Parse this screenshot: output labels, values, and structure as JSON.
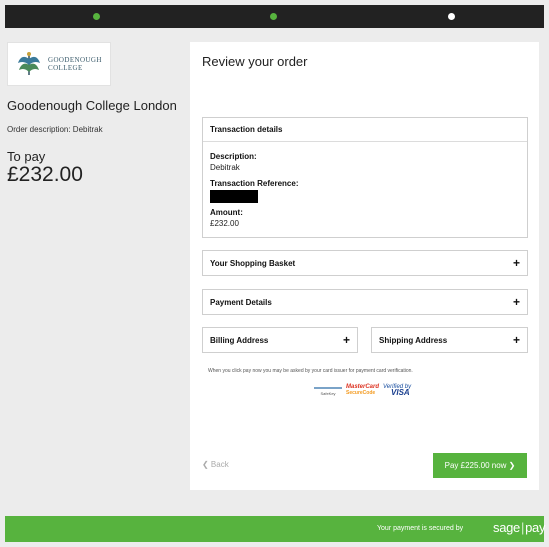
{
  "progress": {
    "total_steps": 3,
    "completed_steps": 2,
    "current_step": 3
  },
  "brand": {
    "logo_line1": "GOODENOUGH",
    "logo_line2": "COLLEGE",
    "crest_icon": "college-crest-icon",
    "accent_color": "#57b33e"
  },
  "summary": {
    "merchant": "Goodenough College London",
    "order_description": "Order description: Debitrak",
    "to_pay_label": "To pay",
    "to_pay_amount": "£232.00"
  },
  "review": {
    "title": "Review your order",
    "transaction": {
      "header": "Transaction details",
      "description_label": "Description:",
      "description_value": "Debitrak",
      "reference_label": "Transaction Reference:",
      "amount_label": "Amount:",
      "amount_value": "£232.00"
    },
    "sections": {
      "basket": "Your Shopping Basket",
      "payment": "Payment Details",
      "billing": "Billing Address",
      "shipping": "Shipping Address"
    },
    "expand_symbol": "+",
    "verification_note": "When you click pay now you may be asked by your card issuer for payment card verification.",
    "card_logos": {
      "safekey_text": "SafeKey",
      "mastercard_text": "MasterCard",
      "securecode_text": "SecureCode",
      "verified_by_text": "Verified by",
      "visa_text": "VISA"
    },
    "back_label": "❮ Back",
    "pay_label": "Pay £225.00 now ❯"
  },
  "footer": {
    "secure_text": "Your payment is secured by",
    "sage_text": "sage",
    "pay_text": "pay"
  }
}
